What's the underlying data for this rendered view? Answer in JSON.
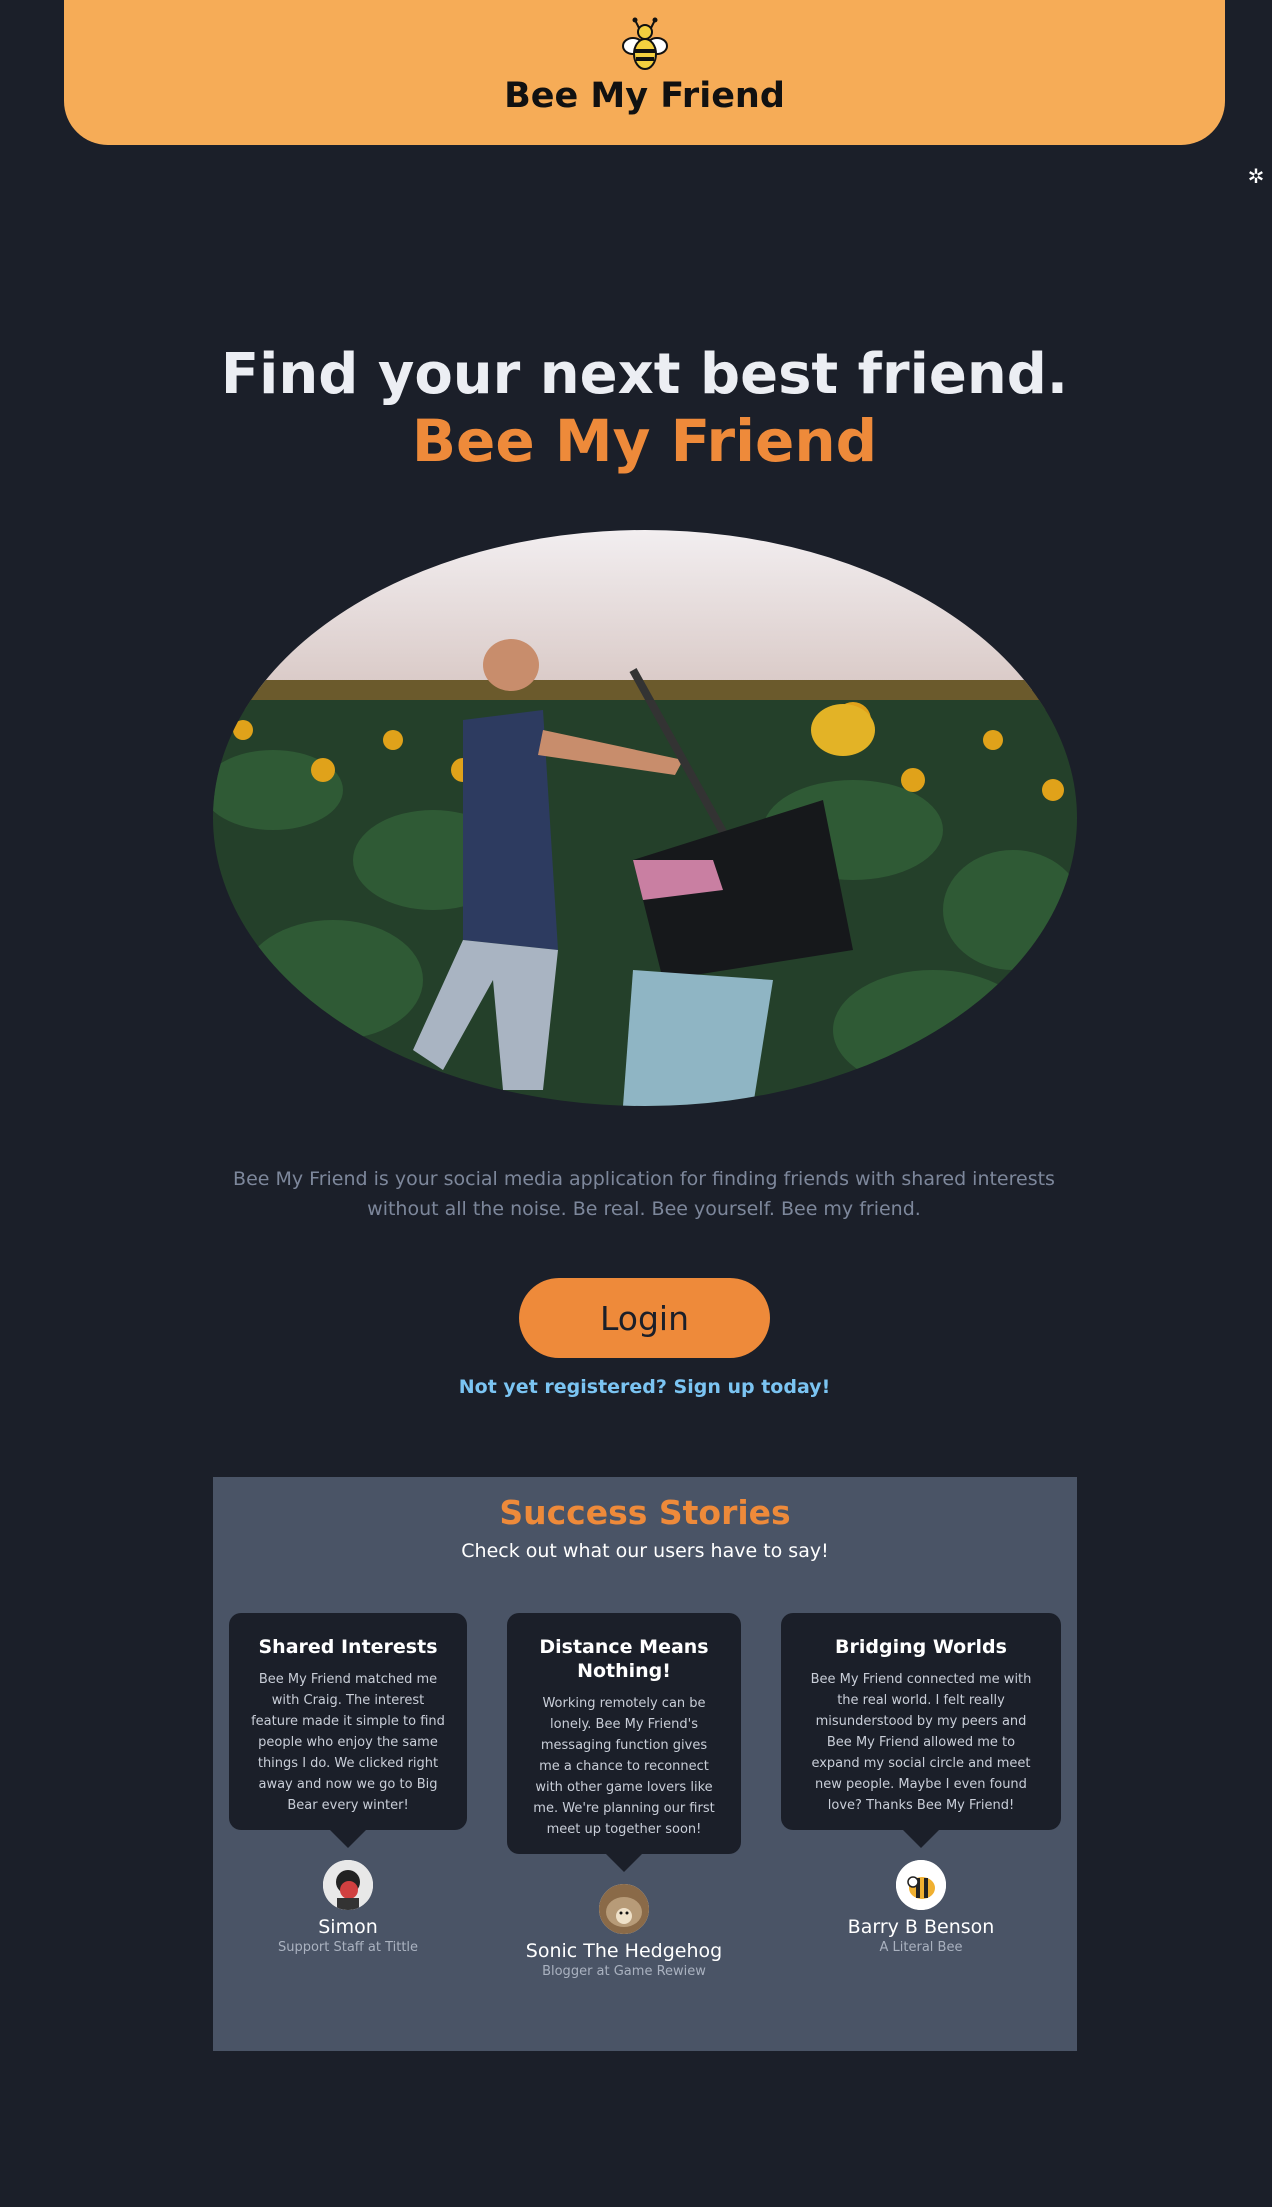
{
  "header": {
    "brand": "Bee My Friend",
    "logo_icon": "bee-icon",
    "settings_icon": "gear-icon"
  },
  "hero": {
    "title": "Find your next best friend.",
    "subtitle": "Bee My Friend",
    "image_alt": "two-men-sunflower-field-photo"
  },
  "description": "Bee My Friend is your social media application for finding friends with shared interests without all the noise. Be real. Bee yourself. Bee my friend.",
  "login": {
    "button_label": "Login",
    "signup_link": "Not yet registered? Sign up today!"
  },
  "stories": {
    "title": "Success Stories",
    "subtitle": "Check out what our users have to say!",
    "items": [
      {
        "title": "Shared Interests",
        "text": "Bee My Friend matched me with Craig. The interest feature made it simple to find people who enjoy the same things I do. We clicked right away and now we go to Big Bear every winter!",
        "author": "Simon",
        "role": "Support Staff at Tittle"
      },
      {
        "title": "Distance Means Nothing!",
        "text": "Working remotely can be lonely. Bee My Friend's messaging function gives me a chance to reconnect with other game lovers like me. We're planning our first meet up together soon!",
        "author": "Sonic The Hedgehog",
        "role": "Blogger at Game Rewiew"
      },
      {
        "title": "Bridging Worlds",
        "text": "Bee My Friend connected me with the real world. I felt really misunderstood by my peers and Bee My Friend allowed me to expand my social circle and meet new people. Maybe I even found love? Thanks Bee My Friend!",
        "author": "Barry B Benson",
        "role": "A Literal Bee"
      }
    ]
  },
  "colors": {
    "background": "#1b1f29",
    "header": "#f6ac57",
    "accent": "#ee8a3a",
    "link": "#7bc4f2",
    "stories_panel": "#4a5466"
  }
}
